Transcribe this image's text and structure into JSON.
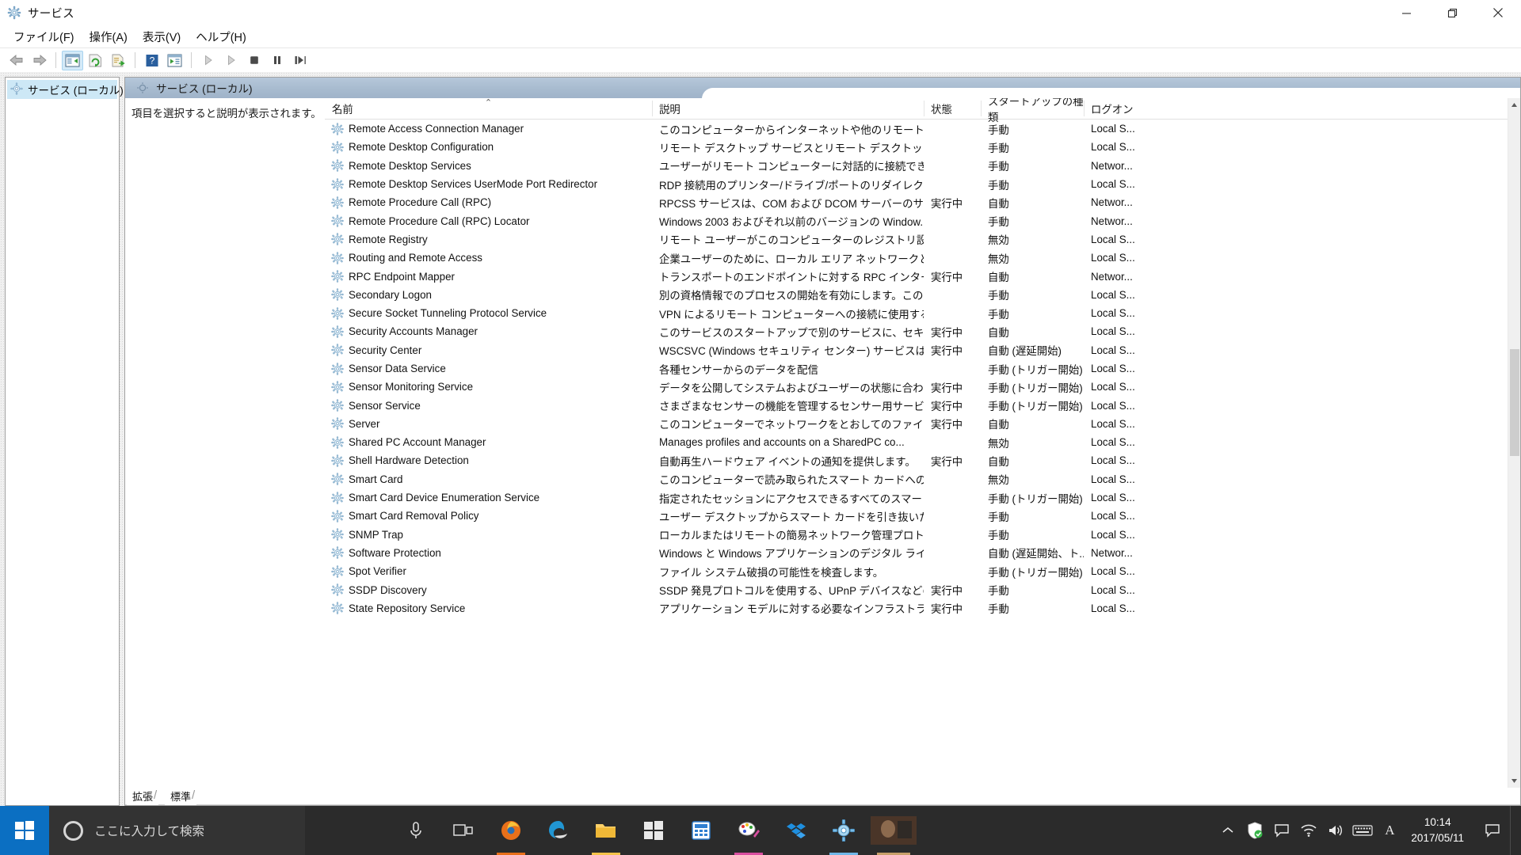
{
  "window": {
    "title": "サービス",
    "title_icon": "services-gear-icon",
    "controls": {
      "minimize": "最小化",
      "restore": "元のサイズに戻す",
      "close": "閉じる"
    }
  },
  "menu": {
    "items": [
      {
        "name": "menu-file",
        "label": "ファイル(F)"
      },
      {
        "name": "menu-action",
        "label": "操作(A)"
      },
      {
        "name": "menu-view",
        "label": "表示(V)"
      },
      {
        "name": "menu-help",
        "label": "ヘルプ(H)"
      }
    ]
  },
  "toolbar": {
    "buttons": [
      {
        "name": "back-button",
        "icon": "back-arrow-icon",
        "tooltip": "戻る"
      },
      {
        "name": "forward-button",
        "icon": "forward-arrow-icon",
        "tooltip": "進む"
      },
      {
        "name": "show-hide-tree-button",
        "icon": "show-tree-icon",
        "tooltip": "コンソール ツリーの表示/非表示",
        "active": true
      },
      {
        "name": "refresh-button",
        "icon": "refresh-icon",
        "tooltip": "最新の情報に更新"
      },
      {
        "name": "export-list-button",
        "icon": "export-list-icon",
        "tooltip": "一覧のエクスポート"
      },
      {
        "name": "help-button",
        "icon": "help-question-icon",
        "tooltip": "ヘルプ"
      },
      {
        "name": "properties-button",
        "icon": "properties-icon",
        "tooltip": "プロパティ"
      },
      {
        "name": "start-service-button",
        "icon": "play-triangle-icon",
        "tooltip": "サービスの開始"
      },
      {
        "name": "resume-service-button",
        "icon": "play-triangle-icon",
        "tooltip": "サービスの再開"
      },
      {
        "name": "stop-service-button",
        "icon": "stop-square-icon",
        "tooltip": "サービスの停止"
      },
      {
        "name": "pause-service-button",
        "icon": "pause-bars-icon",
        "tooltip": "サービスの一時停止"
      },
      {
        "name": "restart-service-button",
        "icon": "restart-icon",
        "tooltip": "サービスの再起動"
      }
    ]
  },
  "tree": {
    "selected_item": "サービス (ローカル)",
    "item_icon": "services-gear-icon"
  },
  "pane": {
    "header_title": "サービス (ローカル)",
    "header_icon": "services-gear-icon",
    "description_placeholder": "項目を選択すると説明が表示されます。"
  },
  "grid": {
    "columns": [
      {
        "name": "column-name",
        "label": "名前",
        "sorted": "asc"
      },
      {
        "name": "column-desc",
        "label": "説明"
      },
      {
        "name": "column-state",
        "label": "状態"
      },
      {
        "name": "column-start",
        "label": "スタートアップの種類"
      },
      {
        "name": "column-logon",
        "label": "ログオン"
      }
    ],
    "sort_caret": "⌃",
    "rows": [
      {
        "name": "Remote Access Connection Manager",
        "desc": "このコンピューターからインターネットや他のリモート ネットワー...",
        "state": "",
        "startup": "手動",
        "logon": "Local S..."
      },
      {
        "name": "Remote Desktop Configuration",
        "desc": "リモート デスクトップ サービスとリモート デスクトップに関連...",
        "state": "",
        "startup": "手動",
        "logon": "Local S..."
      },
      {
        "name": "Remote Desktop Services",
        "desc": "ユーザーがリモート コンピューターに対話的に接続できるよう...",
        "state": "",
        "startup": "手動",
        "logon": "Networ..."
      },
      {
        "name": "Remote Desktop Services UserMode Port Redirector",
        "desc": "RDP 接続用のプリンター/ドライブ/ポートのリダイレクトを許...",
        "state": "",
        "startup": "手動",
        "logon": "Local S..."
      },
      {
        "name": "Remote Procedure Call (RPC)",
        "desc": "RPCSS サービスは、COM および DCOM サーバーのサービ...",
        "state": "実行中",
        "startup": "自動",
        "logon": "Networ..."
      },
      {
        "name": "Remote Procedure Call (RPC) Locator",
        "desc": "Windows 2003 およびそれ以前のバージョンの Window...",
        "state": "",
        "startup": "手動",
        "logon": "Networ..."
      },
      {
        "name": "Remote Registry",
        "desc": "リモート ユーザーがこのコンピューターのレジストリ設定を変...",
        "state": "",
        "startup": "無効",
        "logon": "Local S..."
      },
      {
        "name": "Routing and Remote Access",
        "desc": "企業ユーザーのために、ローカル エリア ネットワークとワイド ...",
        "state": "",
        "startup": "無効",
        "logon": "Local S..."
      },
      {
        "name": "RPC Endpoint Mapper",
        "desc": "トランスポートのエンドポイントに対する RPC インターフェイ...",
        "state": "実行中",
        "startup": "自動",
        "logon": "Networ..."
      },
      {
        "name": "Secondary Logon",
        "desc": "別の資格情報でのプロセスの開始を有効にします。この...",
        "state": "",
        "startup": "手動",
        "logon": "Local S..."
      },
      {
        "name": "Secure Socket Tunneling Protocol Service",
        "desc": "VPN によるリモート コンピューターへの接続に使用する Sec...",
        "state": "",
        "startup": "手動",
        "logon": "Local S..."
      },
      {
        "name": "Security Accounts Manager",
        "desc": "このサービスのスタートアップで別のサービスに、セキュリティ ...",
        "state": "実行中",
        "startup": "自動",
        "logon": "Local S..."
      },
      {
        "name": "Security Center",
        "desc": "WSCSVC (Windows セキュリティ センター) サービスは、コ...",
        "state": "実行中",
        "startup": "自動 (遅延開始)",
        "logon": "Local S..."
      },
      {
        "name": "Sensor Data Service",
        "desc": "各種センサーからのデータを配信",
        "state": "",
        "startup": "手動 (トリガー開始)",
        "logon": "Local S..."
      },
      {
        "name": "Sensor Monitoring Service",
        "desc": "データを公開してシステムおよびユーザーの状態に合わせる...",
        "state": "実行中",
        "startup": "手動 (トリガー開始)",
        "logon": "Local S..."
      },
      {
        "name": "Sensor Service",
        "desc": "さまざまなセンサーの機能を管理するセンサー用サービス。...",
        "state": "実行中",
        "startup": "手動 (トリガー開始)",
        "logon": "Local S..."
      },
      {
        "name": "Server",
        "desc": "このコンピューターでネットワークをとおしてのファイル、印刷...",
        "state": "実行中",
        "startup": "自動",
        "logon": "Local S..."
      },
      {
        "name": "Shared PC Account Manager",
        "desc": "Manages profiles and accounts on a SharedPC co...",
        "state": "",
        "startup": "無効",
        "logon": "Local S..."
      },
      {
        "name": "Shell Hardware Detection",
        "desc": "自動再生ハードウェア イベントの通知を提供します。",
        "state": "実行中",
        "startup": "自動",
        "logon": "Local S..."
      },
      {
        "name": "Smart Card",
        "desc": "このコンピューターで読み取られたスマート カードへのアクセ...",
        "state": "",
        "startup": "無効",
        "logon": "Local S..."
      },
      {
        "name": "Smart Card Device Enumeration Service",
        "desc": "指定されたセッションにアクセスできるすべてのスマート カー...",
        "state": "",
        "startup": "手動 (トリガー開始)",
        "logon": "Local S..."
      },
      {
        "name": "Smart Card Removal Policy",
        "desc": "ユーザー デスクトップからスマート カードを引き抜いたときに...",
        "state": "",
        "startup": "手動",
        "logon": "Local S..."
      },
      {
        "name": "SNMP Trap",
        "desc": "ローカルまたはリモートの簡易ネットワーク管理プロトコル (S...",
        "state": "",
        "startup": "手動",
        "logon": "Local S..."
      },
      {
        "name": "Software Protection",
        "desc": "Windows と Windows アプリケーションのデジタル ライセ...",
        "state": "",
        "startup": "自動 (遅延開始、ト...",
        "logon": "Networ..."
      },
      {
        "name": "Spot Verifier",
        "desc": "ファイル システム破損の可能性を検査します。",
        "state": "",
        "startup": "手動 (トリガー開始)",
        "logon": "Local S..."
      },
      {
        "name": "SSDP Discovery",
        "desc": "SSDP 発見プロトコルを使用する、UPnP デバイスなどのネ...",
        "state": "実行中",
        "startup": "手動",
        "logon": "Local S..."
      },
      {
        "name": "State Repository Service",
        "desc": "アプリケーション モデルに対する必要なインフラストラクチャ ...",
        "state": "実行中",
        "startup": "手動",
        "logon": "Local S..."
      }
    ]
  },
  "tabs": [
    {
      "name": "tab-extended",
      "label": "拡張",
      "selected": true
    },
    {
      "name": "tab-standard",
      "label": "標準",
      "selected": false
    }
  ],
  "scrollbar": {
    "up_arrow": "▲",
    "down_arrow": "▼"
  },
  "taskbar": {
    "start_label": "スタート",
    "search_placeholder": "ここに入力して検索",
    "search_icon": "cortana-circle-icon",
    "pinned": [
      {
        "name": "taskbar-microphone",
        "icon": "microphone-icon",
        "color": "#d8d8d8"
      },
      {
        "name": "taskbar-task-view",
        "icon": "task-view-icon",
        "color": "#d8d8d8"
      },
      {
        "name": "taskbar-firefox",
        "icon": "firefox-icon",
        "color": "#e8701a"
      },
      {
        "name": "taskbar-edge",
        "icon": "edge-icon",
        "color": "#1a8fd1"
      },
      {
        "name": "taskbar-file-explorer",
        "icon": "folder-icon",
        "color": "#f5c24a"
      },
      {
        "name": "taskbar-store",
        "icon": "store-icon",
        "color": "#ffffff"
      },
      {
        "name": "taskbar-calculator",
        "icon": "calculator-icon",
        "color": "#2f7fd1"
      },
      {
        "name": "taskbar-paint",
        "icon": "paint-icon",
        "color": "#d94fa0"
      },
      {
        "name": "taskbar-dropbox",
        "icon": "dropbox-icon",
        "color": "#1e8fe0"
      },
      {
        "name": "taskbar-services",
        "icon": "services-gear-icon",
        "color": "#6fb7e8"
      },
      {
        "name": "taskbar-media",
        "icon": "media-thumbnail-icon",
        "color": "#5a3a2a"
      }
    ],
    "tray": [
      {
        "name": "tray-show-hidden-icons",
        "icon": "chevron-up-icon"
      },
      {
        "name": "tray-security",
        "icon": "shield-check-icon",
        "color": "#39b54a"
      },
      {
        "name": "tray-action-center",
        "icon": "speech-bubble-icon"
      },
      {
        "name": "tray-network",
        "icon": "wifi-icon"
      },
      {
        "name": "tray-volume",
        "icon": "speaker-icon"
      },
      {
        "name": "tray-keyboard",
        "icon": "keyboard-icon"
      },
      {
        "name": "tray-ime",
        "icon": "ime-letter-a-icon",
        "label": "A"
      }
    ],
    "clock": {
      "time": "10:14",
      "date": "2017/05/11"
    }
  },
  "colors": {
    "accent_blue": "#0b6fc2",
    "pane_header_from": "#b6c7da",
    "pane_header_to": "#9fb3c9",
    "tree_selection": "#cde8f6",
    "toolbar_active": "#d4eaf8",
    "taskbar_bg": "#2b2b2b",
    "search_bg": "#333333"
  }
}
